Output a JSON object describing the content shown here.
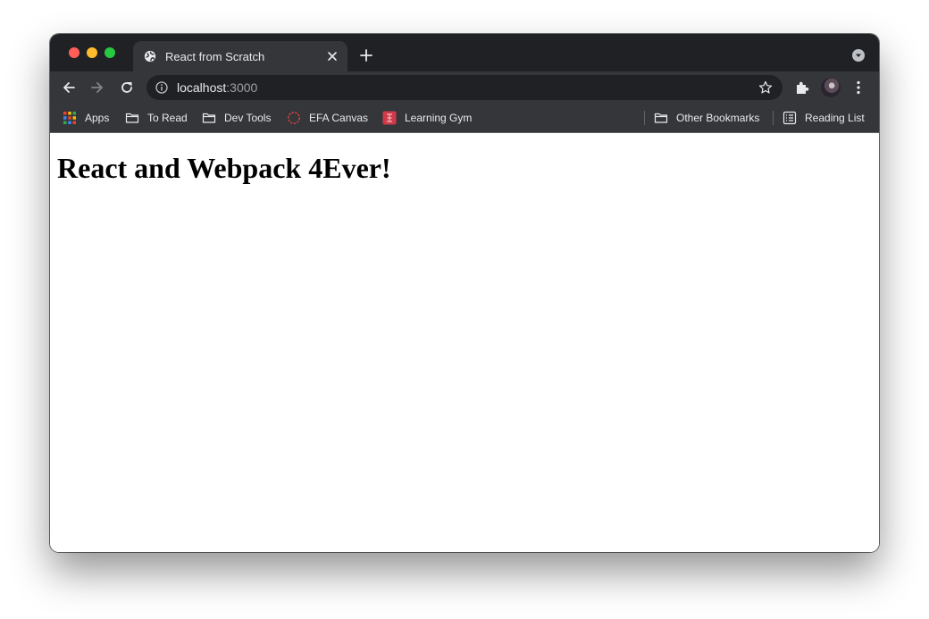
{
  "browser": {
    "tab": {
      "title": "React from Scratch",
      "favicon": "globe-icon"
    },
    "address_bar": {
      "host": "localhost",
      "port": ":3000"
    },
    "bookmarks": {
      "items": [
        {
          "label": "Apps",
          "icon": "apps-grid-icon"
        },
        {
          "label": "To Read",
          "icon": "folder-icon"
        },
        {
          "label": "Dev Tools",
          "icon": "folder-icon"
        },
        {
          "label": "EFA Canvas",
          "icon": "canvas-icon"
        },
        {
          "label": "Learning Gym",
          "icon": "learning-gym-icon"
        }
      ],
      "other_bookmarks": "Other Bookmarks",
      "reading_list": "Reading List"
    },
    "colors": {
      "frame": "#202124",
      "toolbar": "#35363a",
      "text": "#e8eaed",
      "canvas_red": "#d9433a",
      "gym_red": "#cf3a4a"
    }
  },
  "page": {
    "heading": "React and Webpack 4Ever!"
  }
}
